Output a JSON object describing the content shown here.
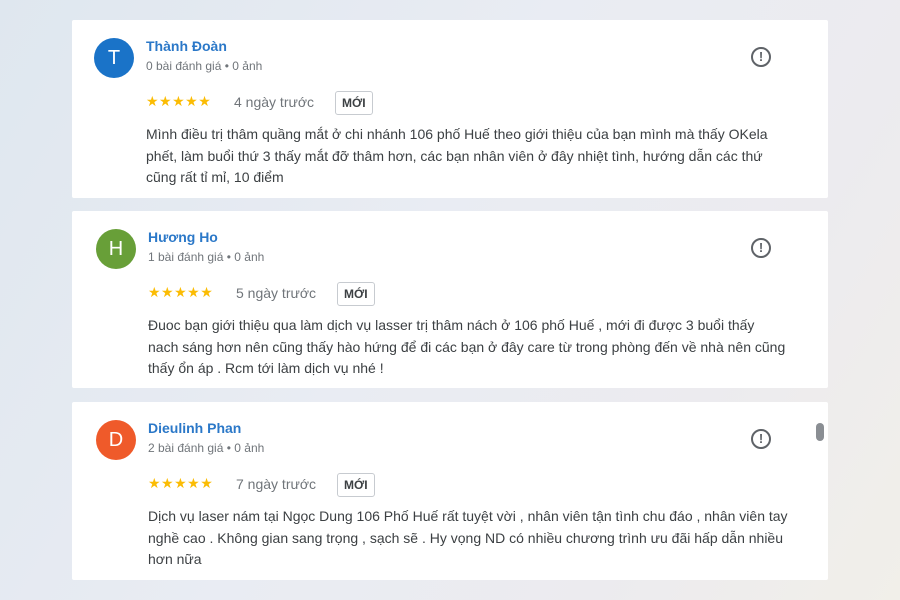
{
  "reviews": [
    {
      "initial": "T",
      "avatar_color": "#1a73c8",
      "name": "Thành Đoàn",
      "meta": "0 bài đánh giá • 0 ảnh",
      "stars": "★★★★★",
      "rating": 5,
      "ago": "4 ngày trước",
      "badge": "MỚI",
      "text": "Mình điều trị thâm quầng mắt ở chi nhánh 106 phố Huế theo giới thiệu của bạn mình mà thấy OKela phết, làm buổi thứ 3 thấy mắt đỡ thâm hơn, các bạn nhân viên ở đây nhiệt tình, hướng dẫn các thứ cũng rất tỉ mỉ, 10 điểm"
    },
    {
      "initial": "H",
      "avatar_color": "#689f38",
      "name": "Hương Ho",
      "meta": "1 bài đánh giá • 0 ảnh",
      "stars": "★★★★★",
      "rating": 5,
      "ago": "5 ngày trước",
      "badge": "MỚI",
      "text": "Đuoc bạn giới thiệu qua làm dịch vụ lasser trị thâm nách ở 106 phố Huế , mới đi được 3 buổi thấy nach sáng hơn nên cũng thấy hào hứng để đi các bạn ở đây care từ trong phòng đến về nhà nên cũng thấy ổn áp . Rcm tới làm dịch vụ nhé !"
    },
    {
      "initial": "D",
      "avatar_color": "#ef5a2a",
      "name": "Dieulinh Phan",
      "meta": "2 bài đánh giá • 0 ảnh",
      "stars": "★★★★★",
      "rating": 5,
      "ago": "7 ngày trước",
      "badge": "MỚI",
      "text": "Dịch vụ laser nám tại Ngọc Dung 106 Phố Huế rất tuyệt vời , nhân viên tận tình chu đáo , nhân viên tay nghề cao . Không gian sang trọng , sạch sẽ . Hy vọng ND có nhiều chương trình ưu đãi hấp dẫn nhiều hơn nữa"
    }
  ],
  "icons": {
    "report": "report-flag-icon",
    "star": "star-icon"
  },
  "colors": {
    "name_link": "#2b78c8",
    "star": "#fbbc04"
  }
}
